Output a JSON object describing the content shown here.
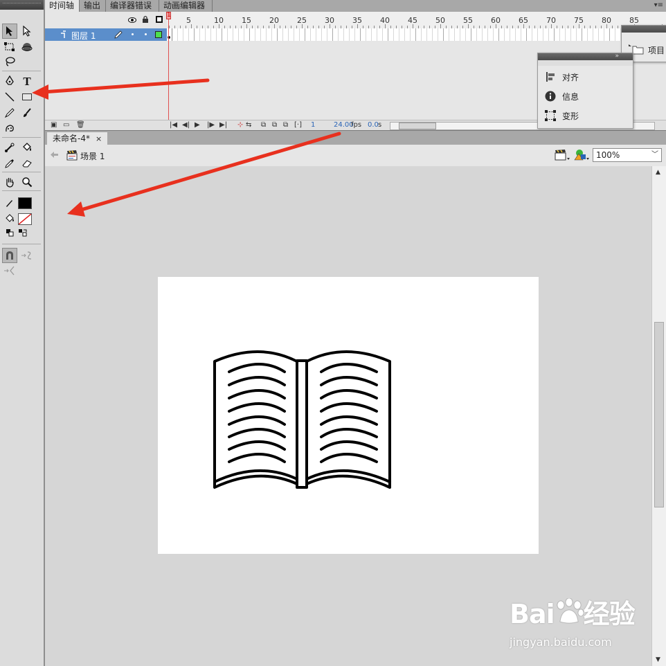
{
  "timeline": {
    "tabs": [
      "时间轴",
      "输出",
      "编译器错误",
      "动画编辑器"
    ],
    "ruler_numbers": [
      "1",
      "5",
      "10",
      "15",
      "20",
      "25",
      "30",
      "35",
      "40",
      "45",
      "50",
      "55",
      "60",
      "65",
      "70",
      "75",
      "80",
      "85"
    ],
    "layer_name": "图层 1",
    "fps": "24.00",
    "fps_unit": "fps",
    "current_frame": "1",
    "elapsed": "0.0",
    "elapsed_unit": "s"
  },
  "panels": {
    "items": [
      "对齐",
      "信息",
      "变形"
    ],
    "project_label": "项目"
  },
  "document": {
    "tab_title": "未命名-4*",
    "close_glyph": "×",
    "scene": "场景 1",
    "zoom": "100%"
  },
  "colors": {
    "stroke": "#000000",
    "fill": "none",
    "layer_highlight": "#5b8ecb",
    "arrow": "#e8301e"
  },
  "watermark": {
    "logo": "Bai du 经验",
    "url": "jingyan.baidu.com"
  }
}
